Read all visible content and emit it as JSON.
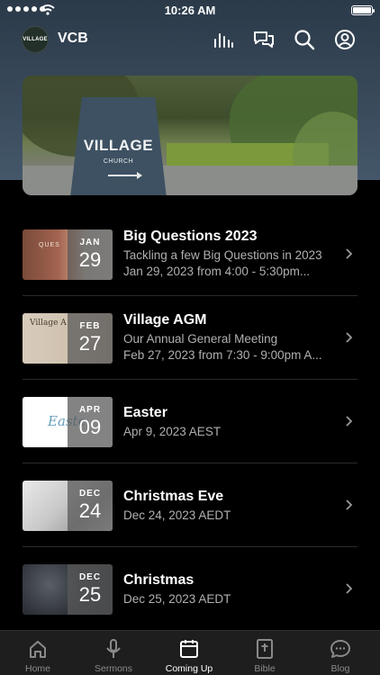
{
  "status_bar": {
    "time": "10:26 AM"
  },
  "header": {
    "logo_text": "VILLAGE",
    "app_name": "VCB"
  },
  "hero": {
    "sign_title": "VILLAGE",
    "sign_subtitle": "CHURCH"
  },
  "events": [
    {
      "month": "JAN",
      "day": "29",
      "title": "Big Questions 2023",
      "subtitle": "Tackling a few Big Questions in 2023",
      "time": "Jan 29, 2023 from 4:00 - 5:30pm...",
      "thumb_text": "QUES"
    },
    {
      "month": "FEB",
      "day": "27",
      "title": "Village AGM",
      "subtitle": "Our Annual General Meeting",
      "time": "Feb 27, 2023 from 7:30 - 9:00pm A...",
      "thumb_text": "Village A"
    },
    {
      "month": "APR",
      "day": "09",
      "title": "Easter",
      "subtitle": "Apr 9, 2023 AEST",
      "time": "",
      "thumb_text": "Easte"
    },
    {
      "month": "DEC",
      "day": "24",
      "title": "Christmas Eve",
      "subtitle": "Dec 24, 2023 AEDT",
      "time": "",
      "thumb_text": ""
    },
    {
      "month": "DEC",
      "day": "25",
      "title": "Christmas",
      "subtitle": "Dec 25, 2023 AEDT",
      "time": "",
      "thumb_text": ""
    }
  ],
  "tabs": [
    {
      "label": "Home",
      "icon": "home-icon"
    },
    {
      "label": "Sermons",
      "icon": "microphone-icon"
    },
    {
      "label": "Coming Up",
      "icon": "calendar-icon",
      "active": true
    },
    {
      "label": "Bible",
      "icon": "bible-icon"
    },
    {
      "label": "Blog",
      "icon": "chat-bubble-icon"
    }
  ]
}
